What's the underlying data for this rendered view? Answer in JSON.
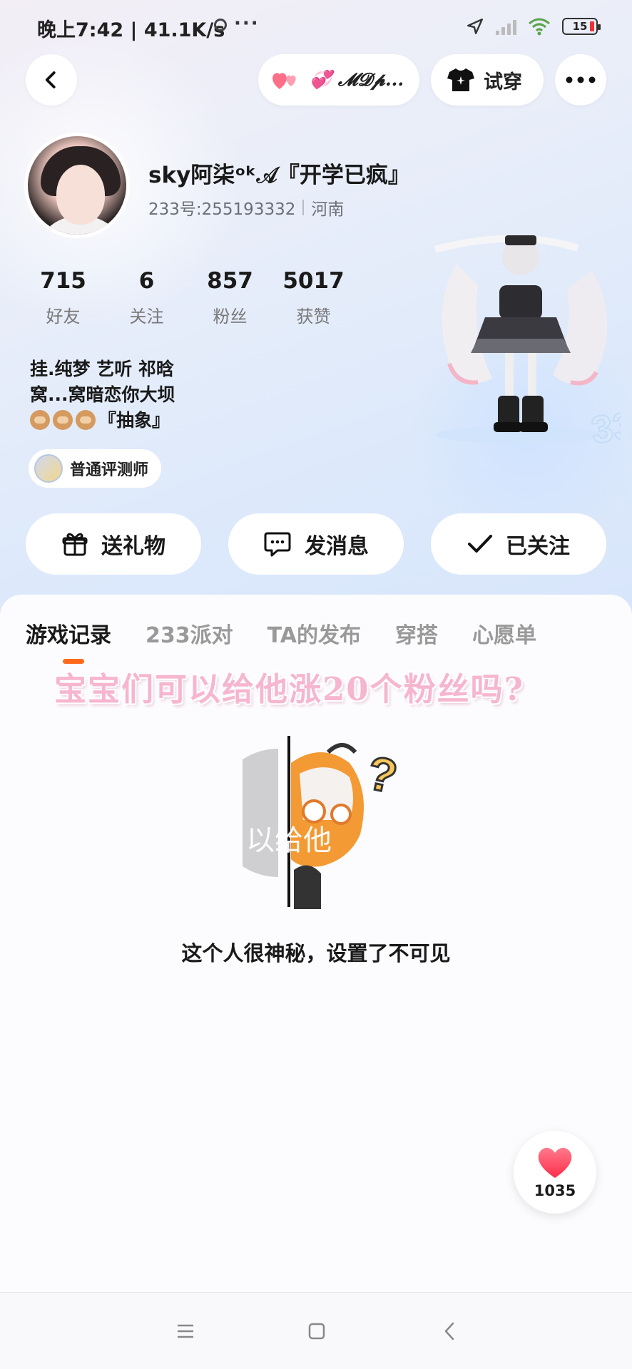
{
  "status_bar": {
    "time": "晚上7:42 | 41.1K/s",
    "more": "···",
    "battery": "15"
  },
  "top_nav": {
    "team_name": "💞 𝓜𝓓𝓹...",
    "tryon_label": "试穿"
  },
  "profile": {
    "username": "sky阿柒ᵒᵏ𝒜『开学已疯』",
    "user_id": "233号:255193332",
    "location": "河南",
    "stats": [
      {
        "num": "715",
        "label": "好友"
      },
      {
        "num": "6",
        "label": "关注"
      },
      {
        "num": "857",
        "label": "粉丝"
      },
      {
        "num": "5017",
        "label": "获赞"
      }
    ],
    "bio_line1": "挂.纯梦 艺听 祁晗",
    "bio_line2": "窝...窝暗恋你大坝",
    "bio_line3": "『抽象』",
    "badge": "普通评测师"
  },
  "actions": {
    "gift": "送礼物",
    "message": "发消息",
    "followed": "已关注"
  },
  "tabs": [
    "游戏记录",
    "233派对",
    "TA的发布",
    "穿搭",
    "心愿单"
  ],
  "overlay_text": "宝宝们可以给他涨20个粉丝吗?",
  "illustration_text": "以给他",
  "empty_text": "这个人很神秘，设置了不可见",
  "like_count": "1035",
  "colors": {
    "accent": "#ff6a1a",
    "heart": "#ff4d6d",
    "overlay_pink": "#f6b6cf"
  }
}
